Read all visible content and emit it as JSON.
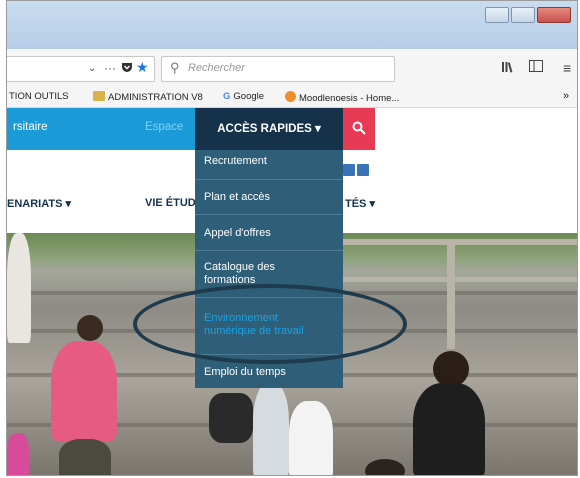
{
  "browser": {
    "search_placeholder": "Rechercher",
    "urlbar_icons": [
      "chevron-down-icon",
      "more-icon",
      "pocket-icon",
      "star-icon"
    ],
    "library_icon": "library-icon",
    "sidebar_icon": "sidebar-icon",
    "menu_icon": "hamburger-icon",
    "overflow_label": "»"
  },
  "bookmarks": {
    "items": [
      {
        "label": "TION OUTILS"
      },
      {
        "label": "ADMINISTRATION V8",
        "icon": "folder-icon"
      },
      {
        "label": "Google",
        "icon": "google-icon"
      },
      {
        "label": "Moodlenoesis - Home...",
        "icon": "moodle-icon"
      }
    ]
  },
  "site": {
    "blue_left": "rsitaire",
    "blue_right": "Espace",
    "acces_label": "ACCÈS RAPIDES ▾",
    "search_button_icon": "search-icon",
    "menu_left": "ENARIATS ▾",
    "menu_mid": "VIE ÉTUD",
    "menu_right": "TÉS ▾"
  },
  "dropdown": {
    "items": [
      {
        "label": "Recrutement"
      },
      {
        "label": "Plan et accès"
      },
      {
        "label": "Appel d'offres"
      },
      {
        "label": "Catalogue des formations"
      },
      {
        "label": "Environnement numérique de travail"
      },
      {
        "label": "Emploi du temps"
      }
    ]
  },
  "colors": {
    "accent_blue": "#1b9ad8",
    "dropdown_bg": "#2f5f78",
    "acces_bg": "#15324a",
    "search_red": "#e63a55"
  }
}
